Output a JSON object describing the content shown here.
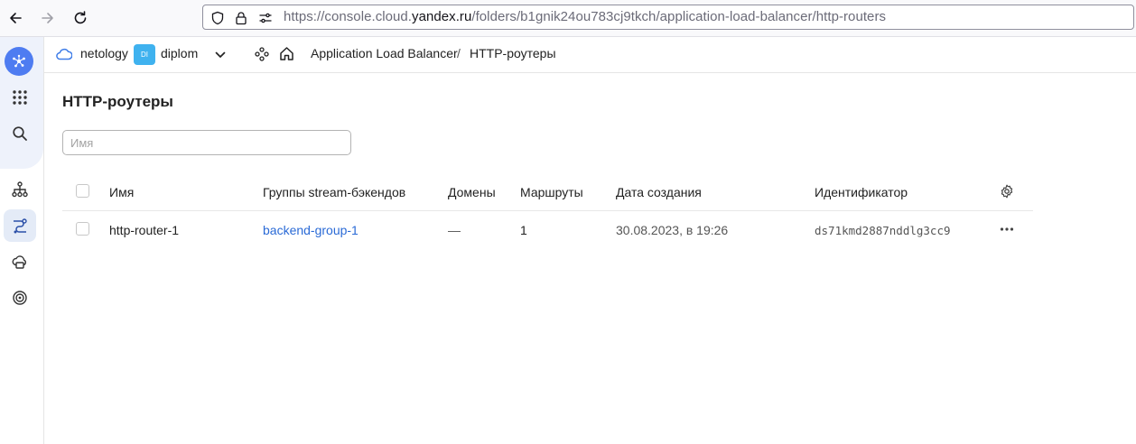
{
  "browser": {
    "url_prefix": "https://console.cloud.",
    "url_domain": "yandex.ru",
    "url_path": "/folders/b1gnik24ou783cj9tkch/application-load-balancer/http-routers"
  },
  "header": {
    "cloud_name": "netology",
    "folder_badge": "DI",
    "folder_name": "diplom",
    "breadcrumb_service": "Application Load Balancer",
    "breadcrumb_sep": "/",
    "breadcrumb_current": "HTTP-роутеры"
  },
  "page": {
    "title": "HTTP-роутеры",
    "search_placeholder": "Имя"
  },
  "table": {
    "columns": [
      "Имя",
      "Группы stream-бэкендов",
      "Домены",
      "Маршруты",
      "Дата создания",
      "Идентификатор"
    ],
    "rows": [
      {
        "name": "http-router-1",
        "backend_group": "backend-group-1",
        "domains": "—",
        "routes": "1",
        "created": "30.08.2023, в 19:26",
        "id": "ds71kmd2887nddlg3cc9"
      }
    ]
  },
  "colors": {
    "accent": "#4e7cf1",
    "link": "#2a6ad6",
    "folder_badge": "#3fb2ef"
  }
}
